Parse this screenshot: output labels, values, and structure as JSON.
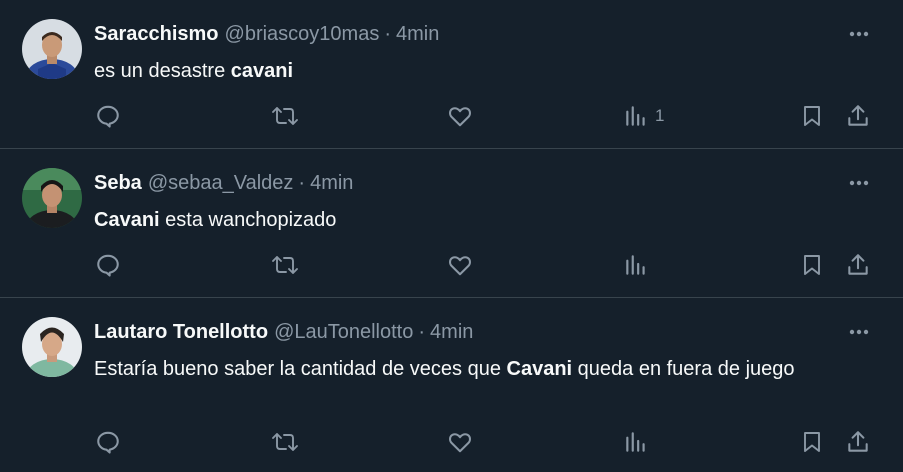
{
  "tweets": [
    {
      "name": "Saracchismo",
      "handle": "@briascoy10mas",
      "separator": "·",
      "time": "4min",
      "text_parts": [
        "es un desastre ",
        "cavani"
      ],
      "views_count": "1"
    },
    {
      "name": "Seba",
      "handle": "@sebaa_Valdez",
      "separator": "·",
      "time": "4min",
      "text_parts": [
        "Cavani",
        " esta wanchopizado"
      ],
      "views_count": ""
    },
    {
      "name": "Lautaro Tonellotto",
      "handle": "@LauTonellotto",
      "separator": "·",
      "time": "4min",
      "text_parts": [
        "Estaría bueno saber la cantidad de veces que ",
        "Cavani",
        " queda en fuera de juego"
      ],
      "views_count": ""
    }
  ],
  "colors": {
    "background": "#15202b",
    "text_primary": "#f7f9f9",
    "text_secondary": "#8b98a5",
    "divider": "#38444d"
  },
  "icons": [
    "reply-icon",
    "retweet-icon",
    "like-icon",
    "views-icon",
    "bookmark-icon",
    "share-icon",
    "more-icon"
  ]
}
